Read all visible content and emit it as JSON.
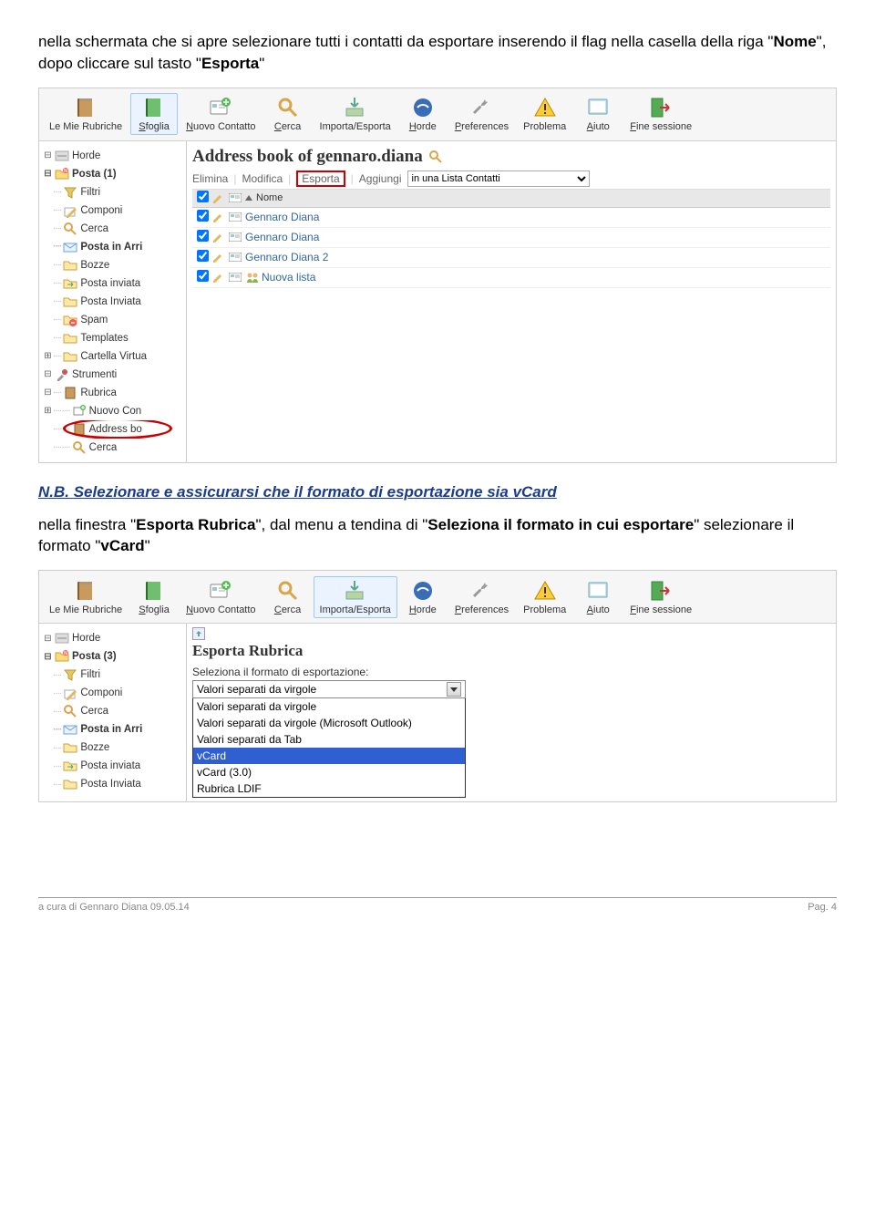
{
  "intro": {
    "line1_a": "nella schermata che si apre selezionare tutti i contatti da esportare inserendo il flag nella casella della riga \"",
    "line1_b": "\", dopo cliccare sul tasto \"",
    "line1_c": "\"",
    "word_nome": "Nome",
    "word_esporta": "Esporta"
  },
  "toolbar": [
    {
      "label": "Le Mie Rubriche",
      "icon": "book"
    },
    {
      "label": "Sfoglia",
      "icon": "book-green",
      "selected": true
    },
    {
      "label": "Nuovo Contatto",
      "icon": "card-plus"
    },
    {
      "label": "Cerca",
      "icon": "magnifier"
    },
    {
      "label": "Importa/Esporta",
      "icon": "import-export"
    },
    {
      "label": "Horde",
      "icon": "horde"
    },
    {
      "label": "Preferences",
      "icon": "wrench"
    },
    {
      "label": "Problema",
      "icon": "alert"
    },
    {
      "label": "Aiuto",
      "icon": "help"
    },
    {
      "label": "Fine sessione",
      "icon": "exit"
    }
  ],
  "tree1": [
    {
      "twist": "-",
      "indent": 0,
      "icon": "horde-sm",
      "label": "Horde"
    },
    {
      "twist": "-",
      "indent": 0,
      "icon": "folder-new",
      "label": "Posta (1)",
      "bold": true
    },
    {
      "indent": 1,
      "icon": "filter",
      "label": "Filtri"
    },
    {
      "indent": 1,
      "icon": "compose",
      "label": "Componi"
    },
    {
      "indent": 1,
      "icon": "magnifier-sm",
      "label": "Cerca"
    },
    {
      "indent": 1,
      "icon": "inbox",
      "label": "Posta in Arri",
      "bold": true
    },
    {
      "indent": 1,
      "icon": "folder",
      "label": "Bozze"
    },
    {
      "indent": 1,
      "icon": "folder-sent",
      "label": "Posta inviata"
    },
    {
      "indent": 1,
      "icon": "folder",
      "label": "Posta Inviata"
    },
    {
      "indent": 1,
      "icon": "spam",
      "label": "Spam"
    },
    {
      "indent": 1,
      "icon": "folder",
      "label": "Templates"
    },
    {
      "twist": "+",
      "indent": 1,
      "icon": "folder",
      "label": "Cartella Virtua"
    },
    {
      "twist": "-",
      "indent": 0,
      "icon": "tools",
      "label": "Strumenti"
    },
    {
      "twist": "-",
      "indent": 1,
      "icon": "book-sm",
      "label": "Rubrica"
    },
    {
      "twist": "+",
      "indent": 2,
      "icon": "nuovo",
      "label": "Nuovo Con"
    },
    {
      "indent": 2,
      "icon": "book-sm",
      "label": "Address bo",
      "circled": true
    },
    {
      "indent": 2,
      "icon": "magnifier-sm",
      "label": "Cerca"
    }
  ],
  "panel1": {
    "title": "Address book of gennaro.diana",
    "actions": {
      "delete": "Elimina",
      "edit": "Modifica",
      "export": "Esporta",
      "add": "Aggiungi",
      "list_value": "in una Lista Contatti"
    },
    "header_name": "Nome",
    "rows": [
      {
        "name": "Gennaro Diana",
        "group": false
      },
      {
        "name": "Gennaro Diana",
        "group": false
      },
      {
        "name": "Gennaro Diana 2",
        "group": false
      },
      {
        "name": "Nuova lista",
        "group": true
      }
    ]
  },
  "nb": {
    "label": "N.B.",
    "text": " Selezionare e assicurarsi che il formato di esportazione sia vCard"
  },
  "intro2": {
    "a": "nella finestra \"",
    "b": "Esporta Rubrica",
    "c": "\", dal menu a tendina di \"",
    "d": "Seleziona il formato in cui esportare",
    "e": "\" selezionare il formato \"",
    "f": "vCard",
    "g": "\""
  },
  "toolbar2_selected": "Importa/Esporta",
  "tree2": [
    {
      "twist": "-",
      "indent": 0,
      "icon": "horde-sm",
      "label": "Horde"
    },
    {
      "twist": "-",
      "indent": 0,
      "icon": "folder-new",
      "label": "Posta (3)",
      "bold": true
    },
    {
      "indent": 1,
      "icon": "filter",
      "label": "Filtri"
    },
    {
      "indent": 1,
      "icon": "compose",
      "label": "Componi"
    },
    {
      "indent": 1,
      "icon": "magnifier-sm",
      "label": "Cerca"
    },
    {
      "indent": 1,
      "icon": "inbox",
      "label": "Posta in Arri",
      "bold": true
    },
    {
      "indent": 1,
      "icon": "folder",
      "label": "Bozze"
    },
    {
      "indent": 1,
      "icon": "folder-sent",
      "label": "Posta inviata"
    },
    {
      "indent": 1,
      "icon": "folder",
      "label": "Posta Inviata"
    }
  ],
  "panel2": {
    "title": "Esporta Rubrica",
    "label": "Seleziona il formato di esportazione:",
    "selected": "Valori separati da virgole",
    "options": [
      "Valori separati da virgole",
      "Valori separati da virgole (Microsoft Outlook)",
      "Valori separati da Tab",
      "vCard",
      "vCard (3.0)",
      "Rubrica LDIF"
    ],
    "highlight_index": 3
  },
  "footer": {
    "left": "a cura di Gennaro Diana  09.05.14",
    "right": "Pag. 4"
  }
}
